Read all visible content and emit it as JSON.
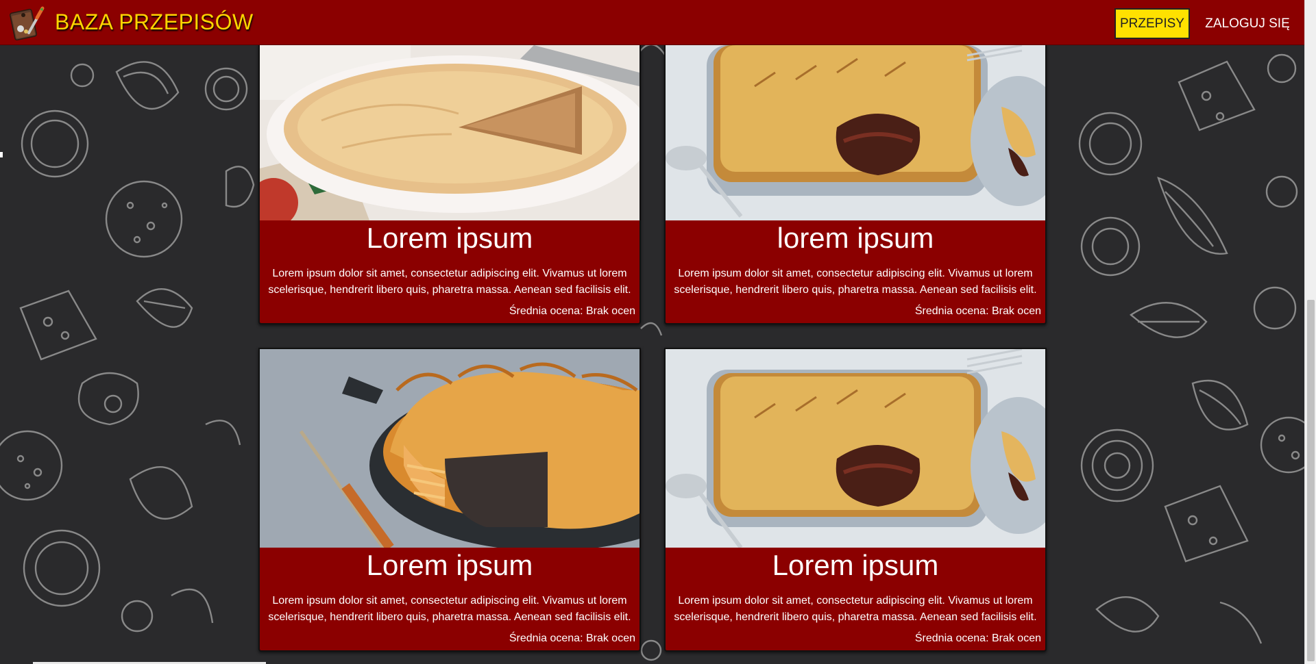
{
  "header": {
    "brand": "BAZA PRZEPISÓW",
    "nav_recipes": "PRZEPISY",
    "nav_login": "ZALOGUJ SIĘ",
    "logo_icon": "cutting-board-icon",
    "colors": {
      "bar": "#8b0000",
      "brand_text": "#ffd400",
      "active_button": "#ffe100"
    }
  },
  "recipes": [
    {
      "title": "Lorem ipsum",
      "description": "Lorem ipsum dolor sit amet, consectetur adipiscing elit. Vivamus ut lorem scelerisque, hendrerit libero quis, pharetra massa. Aenean sed facilisis elit.",
      "rating": "Średnia ocena: Brak ocen",
      "image": "round-pie-photo"
    },
    {
      "title": "lorem ipsum",
      "description": "Lorem ipsum dolor sit amet, consectetur adipiscing elit. Vivamus ut lorem scelerisque, hendrerit libero quis, pharetra massa. Aenean sed facilisis elit.",
      "rating": "Średnia ocena: Brak ocen",
      "image": "rectangular-pie-photo"
    },
    {
      "title": "Lorem ipsum",
      "description": "Lorem ipsum dolor sit amet, consectetur adipiscing elit. Vivamus ut lorem scelerisque, hendrerit libero quis, pharetra massa. Aenean sed facilisis elit.",
      "rating": "Średnia ocena: Brak ocen",
      "image": "skillet-pie-photo"
    },
    {
      "title": "Lorem ipsum",
      "description": "Lorem ipsum dolor sit amet, consectetur adipiscing elit. Vivamus ut lorem scelerisque, hendrerit libero quis, pharetra massa. Aenean sed facilisis elit.",
      "rating": "Średnia ocena: Brak ocen",
      "image": "rectangular-pie-photo"
    }
  ]
}
